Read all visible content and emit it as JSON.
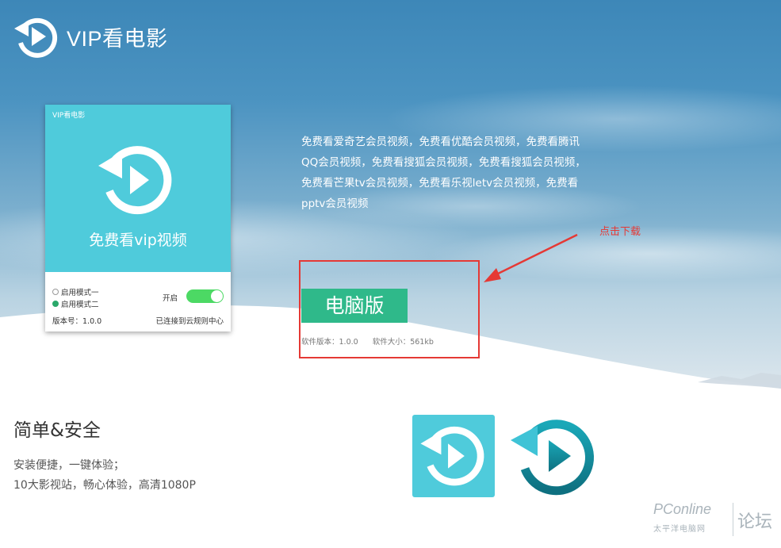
{
  "header": {
    "brand": "VIP看电影"
  },
  "app_preview": {
    "title": "VIP看电影",
    "slogan": "免费看vip视频",
    "mode_1": "启用模式一",
    "mode_2": "启用模式二",
    "selected_mode": 2,
    "toggle_label": "开启",
    "toggle_on": true,
    "version": "版本号：1.0.0",
    "status": "已连接到云规则中心"
  },
  "description": {
    "lines": [
      "免费看爱奇艺会员视频，免费看优酷会员视频，免费看腾讯",
      "QQ会员视频，免费看搜狐会员视频，免费看搜狐会员视频，",
      "免费看芒果tv会员视频，免费看乐视letv会员视频，免费看",
      "pptv会员视频"
    ]
  },
  "annotation": {
    "note": "点击下载"
  },
  "download": {
    "button_label": "电脑版",
    "software_version": "软件版本：1.0.0",
    "software_size": "软件大小：561kb"
  },
  "features": {
    "title": "简单&安全",
    "line1": "安装便捷，一键体验；",
    "line2": "10大影视站，畅心体验，高清1080P"
  },
  "watermark": {
    "brand": "PConline",
    "sub": "太平洋电脑网",
    "forum": "论坛"
  },
  "colors": {
    "accent_cyan": "#4fcbdb",
    "button_green": "#2fb98a",
    "toggle_green": "#4cd964",
    "annotation_red": "#e53935",
    "play_teal_dark": "#137f8f"
  },
  "icons": [
    "replay-play-icon",
    "arrow-icon"
  ]
}
